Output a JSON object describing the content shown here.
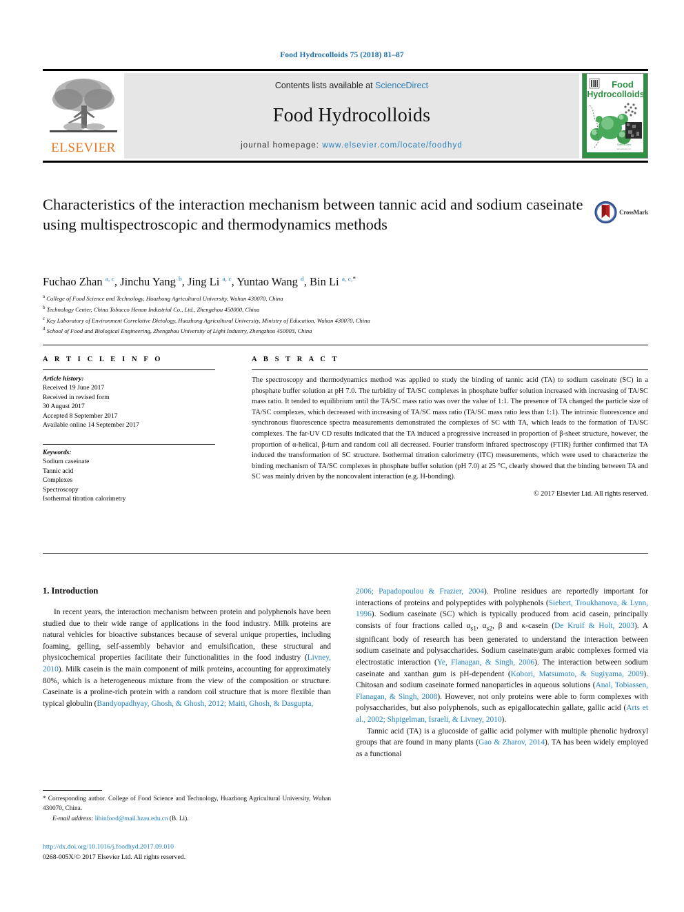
{
  "running_head": "Food Hydrocolloids 75 (2018) 81–87",
  "masthead": {
    "contents_prefix": "Contents lists available at ",
    "sciencedirect": "ScienceDirect",
    "journal_title": "Food Hydrocolloids",
    "homepage_prefix": "journal homepage: ",
    "homepage_url": "www.elsevier.com/locate/foodhyd",
    "publisher": "ELSEVIER",
    "cover_title_line1": "Food",
    "cover_title_line2": "Hydrocolloids",
    "accent_orange": "#E87722",
    "accent_blue": "#2a7fba",
    "cover_green": "#2f8f43"
  },
  "article": {
    "title": "Characteristics of the interaction mechanism between tannic acid and sodium caseinate using multispectroscopic and thermodynamics methods",
    "crossmark_label": "CrossMark",
    "authors_html": "Fuchao Zhan <sup>a, c</sup>, Jinchu Yang <sup>b</sup>, Jing Li <sup>a, c</sup>, Yuntao Wang <sup>d</sup>, Bin Li <sup>a, c,</sup><sup class=\"star\">*</sup>",
    "affiliations": [
      {
        "marker": "a",
        "text": "College of Food Science and Technology, Huazhong Agricultural University, Wuhan 430070, China"
      },
      {
        "marker": "b",
        "text": "Technology Center, China Tobacco Henan Industrial Co., Ltd., Zhengzhou 450000, China"
      },
      {
        "marker": "c",
        "text": "Key Laboratory of Environment Correlative Dietology, Huazhong Agricultural University, Ministry of Education, Wuhan 430070, China"
      },
      {
        "marker": "d",
        "text": "School of Food and Biological Engineering, Zhengzhou University of Light Industry, Zhengzhou 450003, China"
      }
    ]
  },
  "article_info": {
    "heading": "A R T I C L E  I N F O",
    "history_label": "Article history:",
    "history": [
      "Received 19 June 2017",
      "Received in revised form",
      "30 August 2017",
      "Accepted 8 September 2017",
      "Available online 14 September 2017"
    ],
    "keywords_label": "Keywords:",
    "keywords": [
      "Sodium caseinate",
      "Tannic acid",
      "Complexes",
      "Spectroscopy",
      "Isothermal titration calorimetry"
    ]
  },
  "abstract": {
    "heading": "A B S T R A C T",
    "text": "The spectroscopy and thermodynamics method was applied to study the binding of tannic acid (TA) to sodium caseinate (SC) in a phosphate buffer solution at pH 7.0. The turbidity of TA/SC complexes in phosphate buffer solution increased with increasing of TA/SC mass ratio. It tended to equilibrium until the TA/SC mass ratio was over the value of 1:1. The presence of TA changed the particle size of TA/SC complexes, which decreased with increasing of TA/SC mass ratio (TA/SC mass ratio less than 1:1). The intrinsic fluorescence and synchronous fluorescence spectra measurements demonstrated the complexes of SC with TA, which leads to the formation of TA/SC complexes. The far-UV CD results indicated that the TA induced a progressive increased in proportion of β-sheet structure, however, the proportion of α-helical, β-turn and random coil all decreased. Fourier transform infrared spectroscopy (FTIR) further confirmed that TA induced the transformation of SC structure. Isothermal titration calorimetry (ITC) measurements, which were used to characterize the binding mechanism of TA/SC complexes in phosphate buffer solution (pH 7.0) at 25 °C, clearly showed that the binding between TA and SC was mainly driven by the noncovalent interaction (e.g. H-bonding).",
    "copyright": "© 2017 Elsevier Ltd. All rights reserved."
  },
  "introduction": {
    "section_number_title": "1. Introduction",
    "left_paragraph_html": "In recent years, the interaction mechanism between protein and polyphenols have been studied due to their wide range of applications in the food industry. Milk proteins are natural vehicles for bioactive substances because of several unique properties, including foaming, gelling, self-assembly behavior and emulsification, these structural and physicochemical properties facilitate their functionalities in the food industry (<span class=\"ref\">Livney, 2010</span>). Milk casein is the main component of milk proteins, accounting for approximately 80%, which is a heterogeneous mixture from the view of the composition or structure. Caseinate is a proline-rich protein with a random coil structure that is more flexible than typical globulin (<span class=\"ref\">Bandyopadhyay, Ghosh, &amp; Ghosh, 2012; Maiti, Ghosh, &amp; Dasgupta,</span>",
    "right_paragraph_1_html": "<span class=\"ref\">2006; Papadopoulou &amp; Frazier, 2004</span>). Proline residues are reportedly important for interactions of proteins and polypeptides with polyphenols (<span class=\"ref\">Siebert, Troukhanova, &amp; Lynn, 1996</span>). Sodium caseinate (SC) which is typically produced from acid casein, principally consists of four fractions called α<sub>s1</sub>, α<sub>s2</sub>, β and κ-casein (<span class=\"ref\">De Kruif &amp; Holt, 2003</span>). A significant body of research has been generated to understand the interaction between sodium caseinate and polysaccharides. Sodium caseinate/gum arabic complexes formed via electrostatic interaction (<span class=\"ref\">Ye, Flanagan, &amp; Singh, 2006</span>). The interaction between sodium caseinate and xanthan gum is pH-dependent (<span class=\"ref\">Kobori, Matsumoto, &amp; Sugiyama, 2009</span>). Chitosan and sodium caseinate formed nanoparticles in aqueous solutions (<span class=\"ref\">Anal, Tobiassen, Flanagan, &amp; Singh, 2008</span>). However, not only proteins were able to form complexes with polysaccharides, but also polyphenols, such as epigallocatechin gallate, gallic acid (<span class=\"ref\">Arts et al., 2002; Shpigelman, Israeli, &amp; Livney, 2010</span>).",
    "right_paragraph_2_html": "Tannic acid (TA) is a glucoside of gallic acid polymer with multiple phenolic hydroxyl groups that are found in many plants (<span class=\"ref\">Gao &amp; Zharov, 2014</span>). TA has been widely employed as a functional"
  },
  "footnote": {
    "corresponding_html": "<span class=\"star\">*</span> Corresponding author. College of Food Science and Technology, Huazhong Agricultural University, Wuhan 430070, China.",
    "email_label": "E-mail address:",
    "email": "libinfood@mail.hzau.edu.cn",
    "email_suffix": "(B. Li)."
  },
  "footer": {
    "doi": "http://dx.doi.org/10.1016/j.foodhyd.2017.09.010",
    "issn_line": "0268-005X/© 2017 Elsevier Ltd. All rights reserved."
  }
}
